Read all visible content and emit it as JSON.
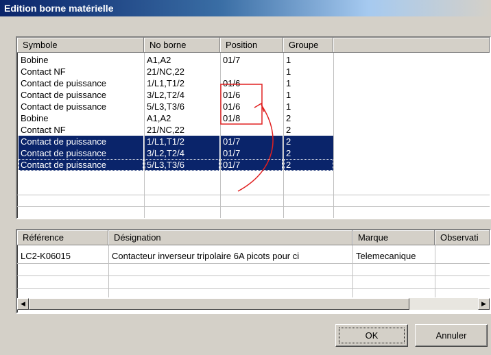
{
  "window": {
    "title": "Edition borne matérielle"
  },
  "top_table": {
    "headers": [
      "Symbole",
      "No borne",
      "Position",
      "Groupe"
    ],
    "rows": [
      {
        "symbole": "Bobine",
        "no_borne": "A1,A2",
        "position": "01/7",
        "groupe": "1"
      },
      {
        "symbole": "Contact NF",
        "no_borne": "21/NC,22",
        "position": "",
        "groupe": "1"
      },
      {
        "symbole": "Contact de puissance",
        "no_borne": "1/L1,T1/2",
        "position": "01/6",
        "groupe": "1"
      },
      {
        "symbole": "Contact de puissance",
        "no_borne": "3/L2,T2/4",
        "position": "01/6",
        "groupe": "1"
      },
      {
        "symbole": "Contact de puissance",
        "no_borne": "5/L3,T3/6",
        "position": "01/6",
        "groupe": "1"
      },
      {
        "symbole": "Bobine",
        "no_borne": "A1,A2",
        "position": "01/8",
        "groupe": "2"
      },
      {
        "symbole": "Contact NF",
        "no_borne": "21/NC,22",
        "position": "",
        "groupe": "2"
      },
      {
        "symbole": "Contact de puissance",
        "no_borne": "1/L1,T1/2",
        "position": "01/7",
        "groupe": "2"
      },
      {
        "symbole": "Contact de puissance",
        "no_borne": "3/L2,T2/4",
        "position": "01/7",
        "groupe": "2"
      },
      {
        "symbole": "Contact de puissance",
        "no_borne": "5/L3,T3/6",
        "position": "01/7",
        "groupe": "2"
      }
    ],
    "selected_rows": [
      7,
      8,
      9
    ]
  },
  "bottom_table": {
    "headers": [
      "Référence",
      "Désignation",
      "Marque",
      "Observati"
    ],
    "rows": [
      {
        "reference": "LC2-K06015",
        "designation": "Contacteur inverseur tripolaire 6A picots pour ci",
        "marque": "Telemecanique",
        "observation": ""
      }
    ]
  },
  "buttons": {
    "ok": "OK",
    "annuler": "Annuler"
  },
  "annotation_color": "#e02020"
}
